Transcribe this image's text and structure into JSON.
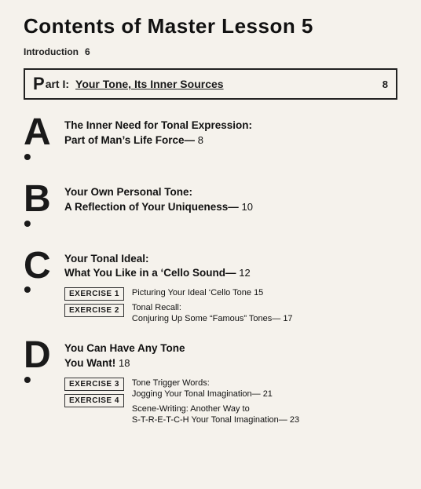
{
  "title": "Contents of Master Lesson 5",
  "intro": {
    "label": "Introduction",
    "page": "6"
  },
  "part1": {
    "label_big": "P",
    "label_rest": "art I:",
    "title_plain": "Your Tone, Its ",
    "title_underline": "Inner",
    "title_after": " Sources",
    "page": "8"
  },
  "sections": [
    {
      "letter": "A",
      "heading_line1": "The Inner Need for Tonal Expression:",
      "heading_line2": "Part of Man’s Life Force—",
      "page": "8",
      "exercises": []
    },
    {
      "letter": "B",
      "heading_line1": "Your Own Personal Tone:",
      "heading_line2": "A Reflection of Your Uniqueness—",
      "page": "10",
      "exercises": []
    },
    {
      "letter": "C",
      "heading_line1": "Your Tonal Ideal:",
      "heading_line2": "What You Like in a ‘Cello Sound—",
      "page": "12",
      "exercises": [
        {
          "label": "EXERCISE 1",
          "desc_line1": "Picturing Your Ideal ‘Cello Tone",
          "desc_page": "15",
          "desc_line2": "",
          "desc_line3": ""
        },
        {
          "label": "EXERCISE 2",
          "desc_line1": "Tonal Recall:",
          "desc_page": "",
          "desc_line2": "Conjuring Up Some “Famous” Tones—",
          "desc_line3": "17"
        }
      ]
    },
    {
      "letter": "D",
      "heading_line1": "You Can Have Any Tone",
      "heading_line2": "You Want!",
      "page": "18",
      "exercises": [
        {
          "label": "EXERCISE 3",
          "desc_line1": "Tone Trigger Words:",
          "desc_page": "",
          "desc_line2": "Jogging Your Tonal Imagination—",
          "desc_line3": "21"
        },
        {
          "label": "EXERCISE 4",
          "desc_line1": "Scene-Writing: Another Way to",
          "desc_page": "",
          "desc_line2": "S-T-R-E-T-C-H Your Tonal Imagination—",
          "desc_line3": "23"
        }
      ]
    }
  ]
}
